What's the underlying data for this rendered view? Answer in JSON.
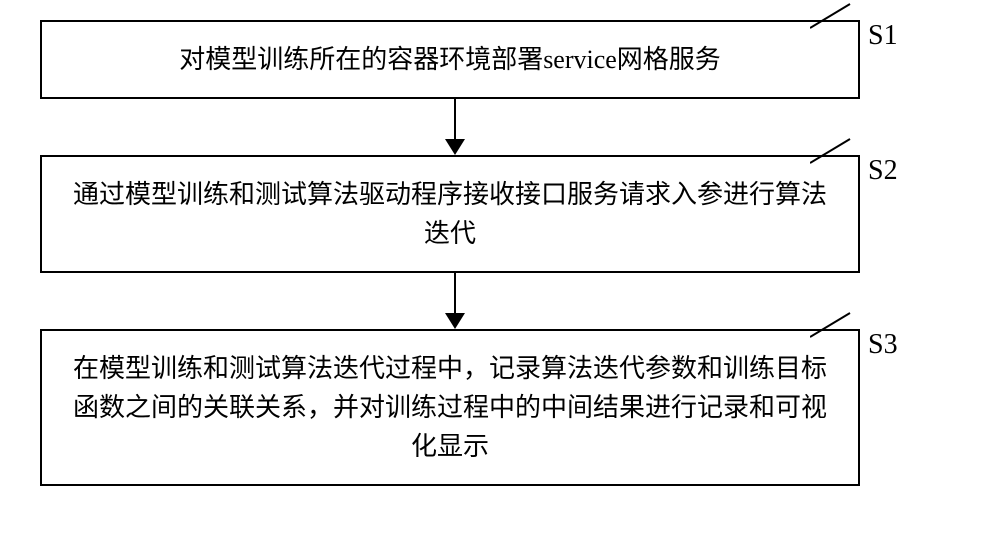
{
  "flowchart": {
    "steps": [
      {
        "label": "S1",
        "text": "对模型训练所在的容器环境部署service网格服务"
      },
      {
        "label": "S2",
        "text": "通过模型训练和测试算法驱动程序接收接口服务请求入参进行算法迭代"
      },
      {
        "label": "S3",
        "text": "在模型训练和测试算法迭代过程中，记录算法迭代参数和训练目标函数之间的关联关系，并对训练过程中的中间结果进行记录和可视化显示"
      }
    ]
  }
}
